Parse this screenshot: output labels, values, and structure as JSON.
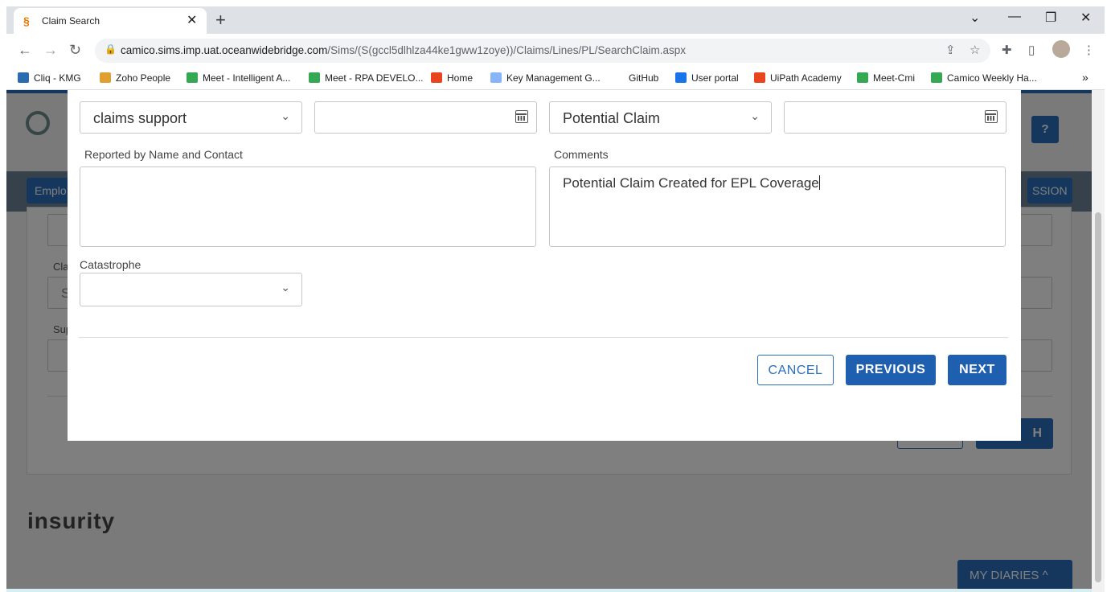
{
  "browser": {
    "tab_title": "Claim Search",
    "tab_close": "✕",
    "new_tab": "+",
    "url_host": "camico.sims.imp.uat.oceanwidebridge.com",
    "url_path": "/Sims/(S(gccl5dlhlza44ke1gww1zoye))/Claims/Lines/PL/SearchClaim.aspx",
    "bookmarks": [
      {
        "label": "Cliq - KMG",
        "color": "#2b6cb0"
      },
      {
        "label": "Zoho People",
        "color": "#e0a030"
      },
      {
        "label": "Meet - Intelligent A...",
        "color": "#34a853"
      },
      {
        "label": "Meet - RPA DEVELO...",
        "color": "#34a853"
      },
      {
        "label": "Home",
        "color": "#e8451e"
      },
      {
        "label": "Key Management G...",
        "color": "#8ab4f8"
      },
      {
        "label": "GitHub",
        "color": "#ffffff"
      },
      {
        "label": "User portal",
        "color": "#1a73e8"
      },
      {
        "label": "UiPath Academy",
        "color": "#e8451e"
      },
      {
        "label": "Meet-Cmi",
        "color": "#34a853"
      },
      {
        "label": "Camico Weekly Ha...",
        "color": "#34a853"
      }
    ],
    "bookmarks_more": "»"
  },
  "background": {
    "help_label": "?",
    "nav_left_label": "Emplo",
    "nav_right_label": "SSION",
    "field_label_1": "Cla",
    "field_value_1": "S",
    "field_label_2": "Sup",
    "search_button_fragment": "H",
    "footer_logo": "insurity",
    "diaries_label": "MY DIARIES ^"
  },
  "modal": {
    "assigned_to_value": "claims support",
    "date_1_value": "",
    "claim_type_value": "Potential Claim",
    "date_2_value": "",
    "reported_by_label": "Reported by Name and Contact",
    "reported_by_value": "",
    "comments_label": "Comments",
    "comments_value": "Potential Claim Created for EPL Coverage",
    "catastrophe_label": "Catastrophe",
    "catastrophe_value": "",
    "cancel_label": "CANCEL",
    "previous_label": "PREVIOUS",
    "next_label": "NEXT"
  },
  "colors": {
    "accent": "#2a6ebb",
    "button_fill": "#1f5fb0"
  }
}
